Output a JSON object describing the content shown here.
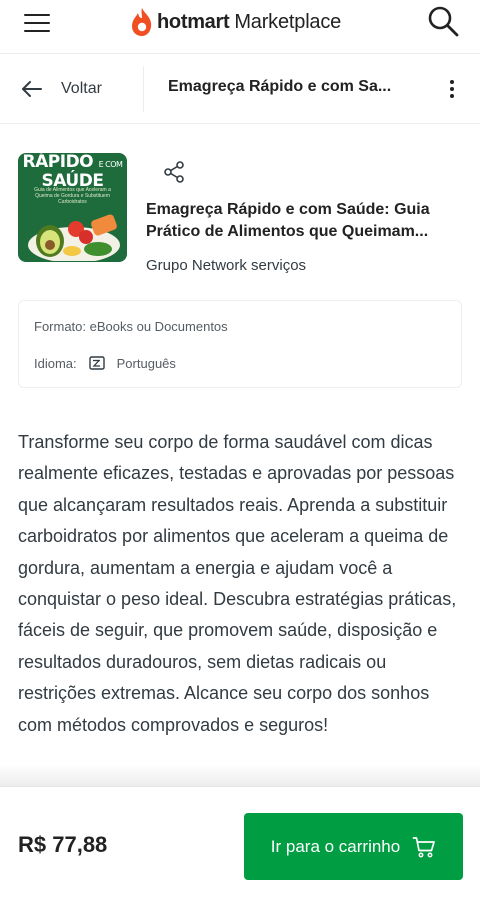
{
  "header": {
    "logo_brand": "hotmart",
    "logo_market": "Marketplace",
    "icons": [
      "menu-icon",
      "hotmart-flame-icon",
      "search-icon"
    ],
    "brand_color": "#f04e23"
  },
  "nav": {
    "back_label": "Voltar",
    "title": "Emagreça Rápido e com Sa..."
  },
  "product": {
    "cover": {
      "title": "RÁPIDO",
      "title_suffix": "E COM",
      "title_line2": "SAÚDE",
      "subtitle": "Guia de Alimentos que Aceleram a Queima de Gordura e Substituem Carboidratos"
    },
    "title": "Emagreça Rápido e com Saúde: Guia Prático de Alimentos que Queimam...",
    "author": "Grupo Network serviços",
    "format_label": "Formato:",
    "format_value": "eBooks ou Documentos",
    "language_label": "Idioma:",
    "language_value": "Português",
    "description": "Transforme seu corpo de forma saudável com dicas realmente eficazes, testadas e aprovadas por pessoas que alcançaram resultados reais. Aprenda a substituir carboidratos por alimentos que aceleram a queima de gordura, aumentam a energia e ajudam você a conquistar o peso ideal. Descubra estratégias práticas, fáceis de seguir, que promovem saúde, disposição e resultados duradouros, sem dietas radicais ou restrições extremas. Alcance seu corpo dos sonhos com métodos comprovados e seguros!"
  },
  "footer": {
    "price": "R$ 77,88",
    "cart_button_label": "Ir para o carrinho",
    "accent_color": "#009d43"
  }
}
